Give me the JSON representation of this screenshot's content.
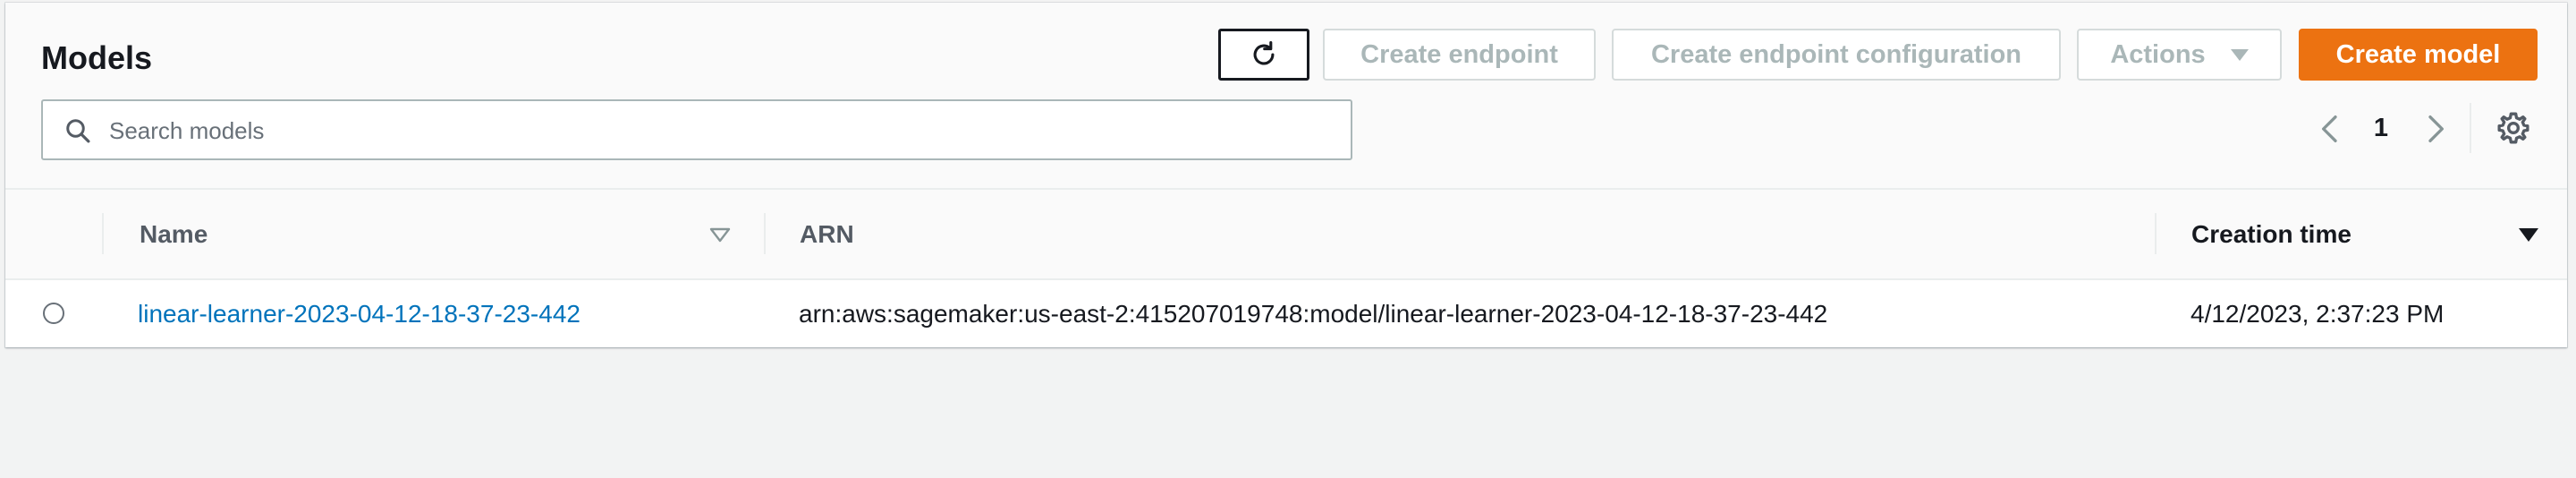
{
  "panel": {
    "title": "Models"
  },
  "toolbar": {
    "refresh_icon": "refresh-icon",
    "create_endpoint_label": "Create endpoint",
    "create_endpoint_config_label": "Create endpoint configuration",
    "actions_label": "Actions",
    "create_model_label": "Create model"
  },
  "search": {
    "placeholder": "Search models",
    "value": ""
  },
  "pagination": {
    "current_page": "1"
  },
  "table": {
    "columns": [
      {
        "label": "Name",
        "sorted": false
      },
      {
        "label": "ARN",
        "sorted": false
      },
      {
        "label": "Creation time",
        "sorted": true,
        "direction": "descending"
      }
    ],
    "rows": [
      {
        "selected": false,
        "name": "linear-learner-2023-04-12-18-37-23-442",
        "arn": "arn:aws:sagemaker:us-east-2:415207019748:model/linear-learner-2023-04-12-18-37-23-442",
        "creation_time": "4/12/2023, 2:37:23 PM"
      }
    ]
  },
  "colors": {
    "primary_button": "#ec7211",
    "link": "#0073bb",
    "disabled_text": "#aab7b8",
    "background": "#f2f3f3"
  }
}
